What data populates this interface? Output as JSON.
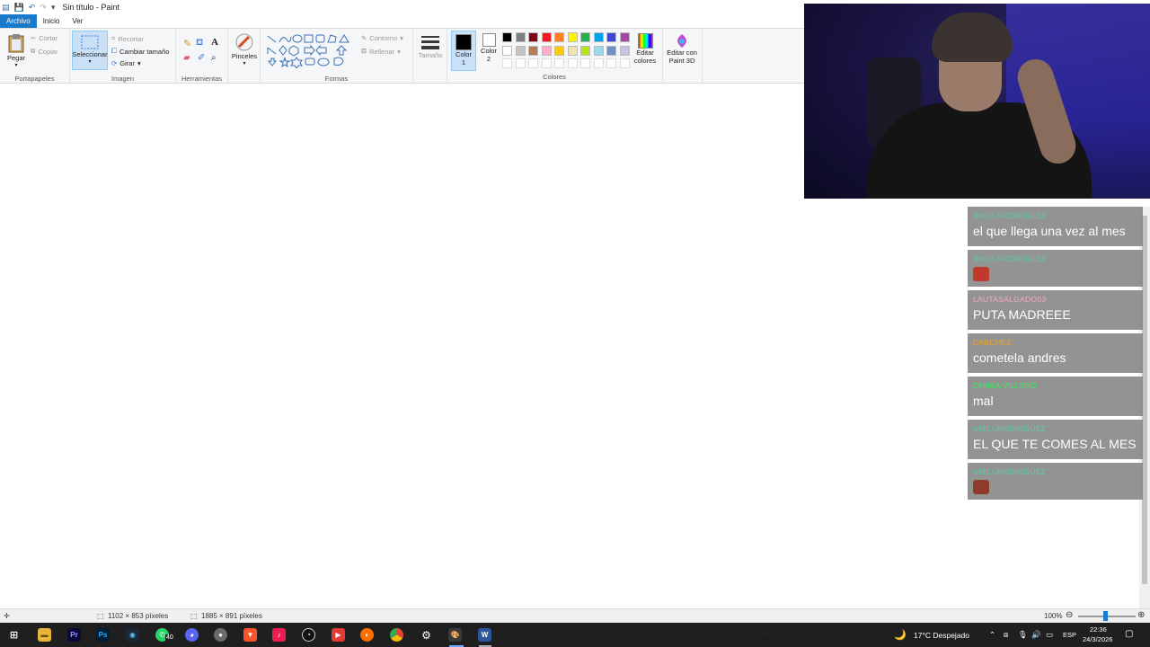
{
  "window": {
    "title": "Sin título - Paint"
  },
  "tabs": [
    {
      "label": "Archivo"
    },
    {
      "label": "Inicio"
    },
    {
      "label": "Ver"
    }
  ],
  "ribbon": {
    "clipboard": {
      "paste": "Pegar",
      "cut": "Cortar",
      "copy": "Copiar",
      "group": "Portapapeles"
    },
    "image": {
      "select": "Seleccionar",
      "crop": "Recortar",
      "resize": "Cambiar tamaño",
      "rotate": "Girar",
      "group": "Imagen"
    },
    "tools": {
      "group": "Herramientas"
    },
    "brushes": {
      "label": "Pinceles"
    },
    "shapes": {
      "outline": "Contorno",
      "fill": "Rellenar",
      "group": "Formas"
    },
    "size": {
      "label": "Tamaño"
    },
    "color1": {
      "label": "Color",
      "num": "1"
    },
    "color2": {
      "label": "Color",
      "num": "2"
    },
    "colors_group": "Colores",
    "edit_colors": {
      "line1": "Editar",
      "line2": "colores"
    },
    "paint3d": {
      "line1": "Editar con",
      "line2": "Paint 3D"
    }
  },
  "palette": {
    "row1": [
      "#000000",
      "#7f7f7f",
      "#880015",
      "#ed1c24",
      "#ff7f27",
      "#fff200",
      "#22b14c",
      "#00a2e8",
      "#3f48cc",
      "#a349a4"
    ],
    "row2": [
      "#ffffff",
      "#c3c3c3",
      "#b97a57",
      "#ffaec9",
      "#ffc90e",
      "#efe4b0",
      "#b5e61d",
      "#99d9ea",
      "#7092be",
      "#c8bfe7"
    ]
  },
  "statusbar": {
    "selection": "1102 × 853 píxeles",
    "canvas_size": "1885 × 891 píxeles",
    "zoom": "100%"
  },
  "chat": [
    {
      "user": "XMILURODRIGUEZ",
      "user_color": "#4fd1a9",
      "text": "el que llega una vez al mes"
    },
    {
      "user": "XMILURODRIGUEZ",
      "user_color": "#4fd1a9",
      "text": "",
      "emote": true
    },
    {
      "user": "LAUTASALGADO03",
      "user_color": "#f3a6c8",
      "text": "PUTA MADREEE"
    },
    {
      "user": "DABCHEZ",
      "user_color": "#f0a21c",
      "text": "cometela andres"
    },
    {
      "user": "ZAMBA VILLERO",
      "user_color": "#2ef05a",
      "text": "mal"
    },
    {
      "user": "XMILURODRIGUEZ",
      "user_color": "#4fd1a9",
      "text": "EL QUE TE COMES AL MES"
    },
    {
      "user": "XMILURODRIGUEZ",
      "user_color": "#4fd1a9",
      "text": "",
      "emote": true
    }
  ],
  "taskbar": {
    "whatsapp_badge": "40",
    "weather": "17°C  Despejado",
    "lang": "ESP",
    "time": "22:36",
    "date": "24/3/2026"
  }
}
